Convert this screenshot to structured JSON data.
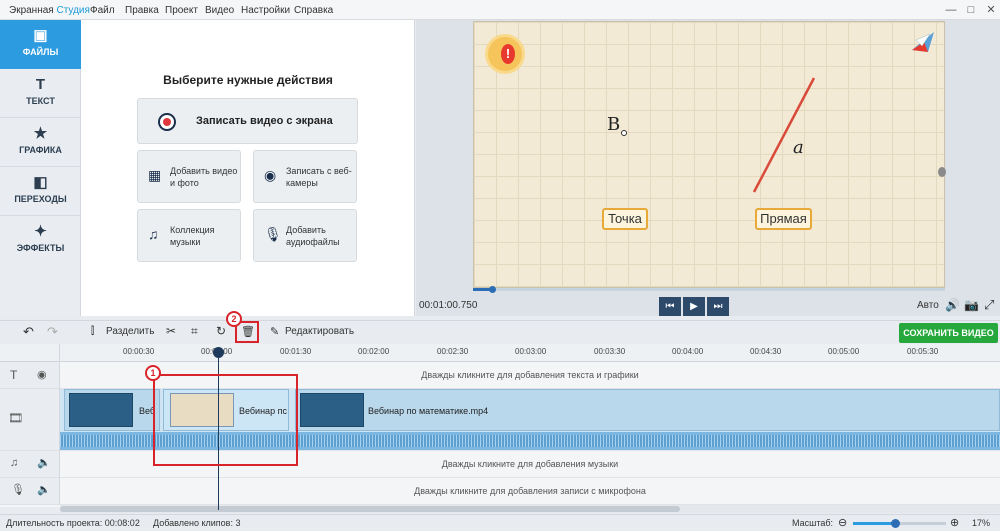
{
  "app": {
    "title_main": "Экранная",
    "title_accent": "Студия"
  },
  "menu": [
    "Файл",
    "Правка",
    "Проект",
    "Видео",
    "Настройки",
    "Справка"
  ],
  "window_controls": {
    "minimize": "—",
    "maximize": "□",
    "close": "✕"
  },
  "sidenav": [
    {
      "label": "ФАЙЛЫ",
      "icon": "folder-icon",
      "glyph": "▣",
      "active": true
    },
    {
      "label": "ТЕКСТ",
      "icon": "text-icon",
      "glyph": "T",
      "active": false
    },
    {
      "label": "ГРАФИКА",
      "icon": "star-icon",
      "glyph": "★",
      "active": false
    },
    {
      "label": "ПЕРЕХОДЫ",
      "icon": "transitions-icon",
      "glyph": "◧",
      "active": false
    },
    {
      "label": "ЭФФЕКТЫ",
      "icon": "magic-wand-icon",
      "glyph": "✦",
      "active": false
    }
  ],
  "actions": {
    "heading": "Выберите нужные действия",
    "record": "Записать видео с экрана",
    "add_video": "Добавить видео и фото",
    "record_webcam": "Записать с веб-камеры",
    "music_collection": "Коллекция музыки",
    "add_audio": "Добавить аудиофайлы"
  },
  "preview": {
    "point_label": "B",
    "line_label": "a",
    "box_point": "Точка",
    "box_line": "Прямая",
    "progress": 0.04,
    "time": "00:01:00.750",
    "quality": "Авто"
  },
  "transport": {
    "prev": "⏮",
    "play": "▶",
    "next": "⏭"
  },
  "toolbar": {
    "undo": "↶",
    "redo": "↷",
    "split": "Разделить",
    "edit": "Редактировать",
    "save": "СОХРАНИТЬ ВИДЕО"
  },
  "ruler": [
    "00:00:30",
    "00:01:00",
    "00:01:30",
    "00:02:00",
    "00:02:30",
    "00:03:00",
    "00:03:30",
    "00:04:00",
    "00:04:30",
    "00:05:00",
    "00:05:30"
  ],
  "tracks": {
    "text_hint": "Дважды кликните для добавления текста и графики",
    "music_hint": "Дважды кликните для добавления музыки",
    "mic_hint": "Дважды кликните для добавления записи с микрофона"
  },
  "clips": [
    {
      "name": "Веб"
    },
    {
      "name": "Вебинар пс"
    },
    {
      "name": "Вебинар по математике.mp4"
    }
  ],
  "annotations": {
    "one": "1",
    "two": "2"
  },
  "status": {
    "duration": "Длительность проекта: 00:08:02",
    "clips_added": "Добавлено клипов: 3",
    "scale_label": "Масштаб:",
    "zoom": "17%",
    "zoom_level": 0.45
  },
  "colors": {
    "accent": "#2d9be0",
    "save": "#27a83c",
    "highlight": "#d9232a"
  }
}
